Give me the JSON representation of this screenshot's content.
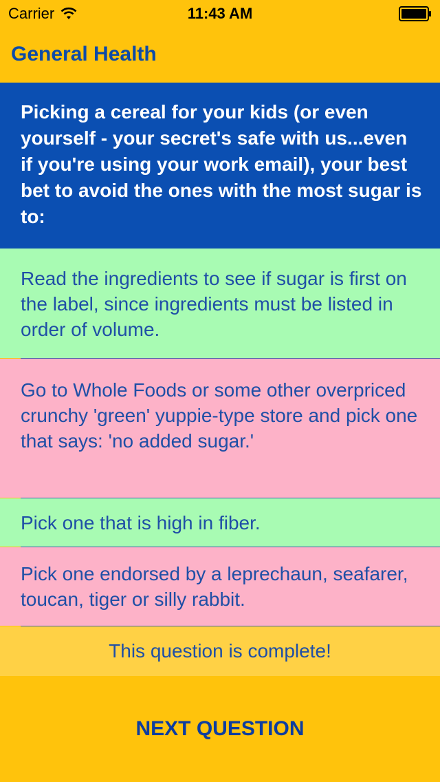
{
  "status_bar": {
    "carrier": "Carrier",
    "time": "11:43 AM",
    "wifi_icon": "wifi-icon",
    "battery_icon": "battery-icon"
  },
  "nav": {
    "title": "General Health"
  },
  "question": {
    "text": "Picking a cereal for your kids (or even yourself - your secret's safe with us...even if you're using your work email), your best bet to avoid the ones with the most sugar is to:"
  },
  "answers": [
    {
      "text": "Read the ingredients to see if sugar is first on the label, since ingredients must be listed in order of volume.",
      "state": "correct",
      "color": "#A8FBB3"
    },
    {
      "text": "Go to Whole Foods or some other overpriced crunchy 'green' yuppie-type store and pick one that says: 'no added sugar.'",
      "state": "incorrect",
      "color": "#FDB2C8"
    },
    {
      "text": "Pick one that is high in fiber.",
      "state": "correct",
      "color": "#A8FBB3"
    },
    {
      "text": "Pick one endorsed by a leprechaun, seafarer, toucan, tiger or silly rabbit.",
      "state": "incorrect",
      "color": "#FDB2C8"
    }
  ],
  "status_message": "This question is complete!",
  "next_button": {
    "label": "NEXT QUESTION"
  },
  "colors": {
    "background": "#FFC30C",
    "question_bg": "#0B4FB2",
    "text_blue": "#1F4FA6",
    "complete_bg": "#FFD145"
  }
}
